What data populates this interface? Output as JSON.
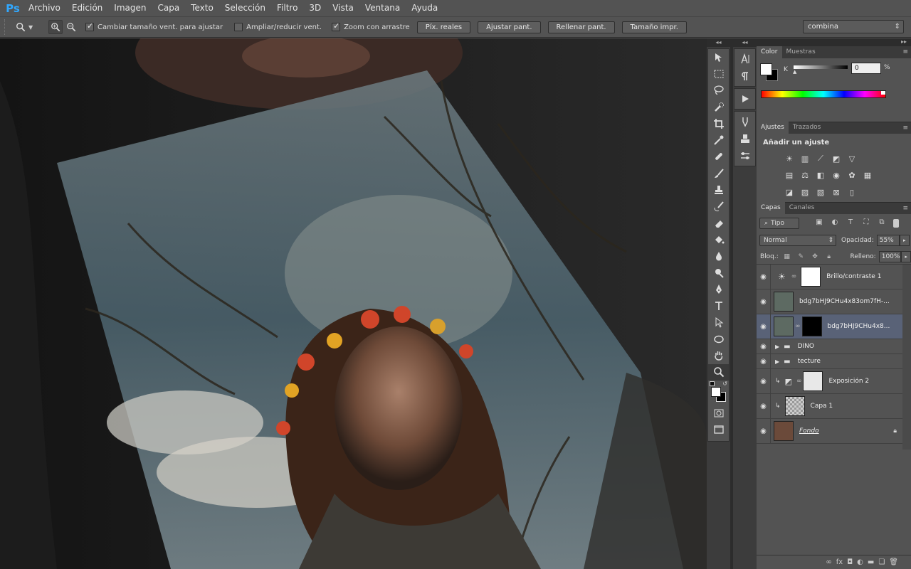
{
  "app": {
    "logo": "Ps"
  },
  "menu": [
    "Archivo",
    "Edición",
    "Imagen",
    "Capa",
    "Texto",
    "Selección",
    "Filtro",
    "3D",
    "Vista",
    "Ventana",
    "Ayuda"
  ],
  "options": {
    "resize_windows": "Cambiar tamaño vent. para ajustar",
    "zoom_all": "Ampliar/reducir vent.",
    "scrubby_zoom": "Zoom con arrastre",
    "btn_actual": "Píx. reales",
    "btn_fit": "Ajustar pant.",
    "btn_fill": "Rellenar pant.",
    "btn_print": "Tamaño impr.",
    "workspace": "combina"
  },
  "color_panel": {
    "tab_active": "Color",
    "tab_other": "Muestras",
    "channel": "K",
    "value": "0",
    "unit": "%"
  },
  "adjustments_panel": {
    "tab_active": "Ajustes",
    "tab_other": "Trazados",
    "title": "Añadir un ajuste"
  },
  "layers_panel": {
    "tab_active": "Capas",
    "tab_other": "Canales",
    "filter_kind": "Tipo",
    "blend_mode": "Normal",
    "opacity_label": "Opacidad:",
    "opacity": "55%",
    "lock_label": "Bloq.:",
    "fill_label": "Relleno:",
    "fill": "100%",
    "layers": [
      {
        "name": "Brillo/contraste 1"
      },
      {
        "name": "bdg7bHJ9CHu4x83om7fH-..."
      },
      {
        "name": "bdg7bHJ9CHu4x8..."
      },
      {
        "name": "DINO"
      },
      {
        "name": "tecture"
      },
      {
        "name": "Exposición 2"
      },
      {
        "name": "Capa 1"
      },
      {
        "name": "Fondo"
      }
    ]
  },
  "colors": {
    "accent": "#31a8ff",
    "ui_bg": "#535353",
    "selected_layer": "#596277"
  }
}
